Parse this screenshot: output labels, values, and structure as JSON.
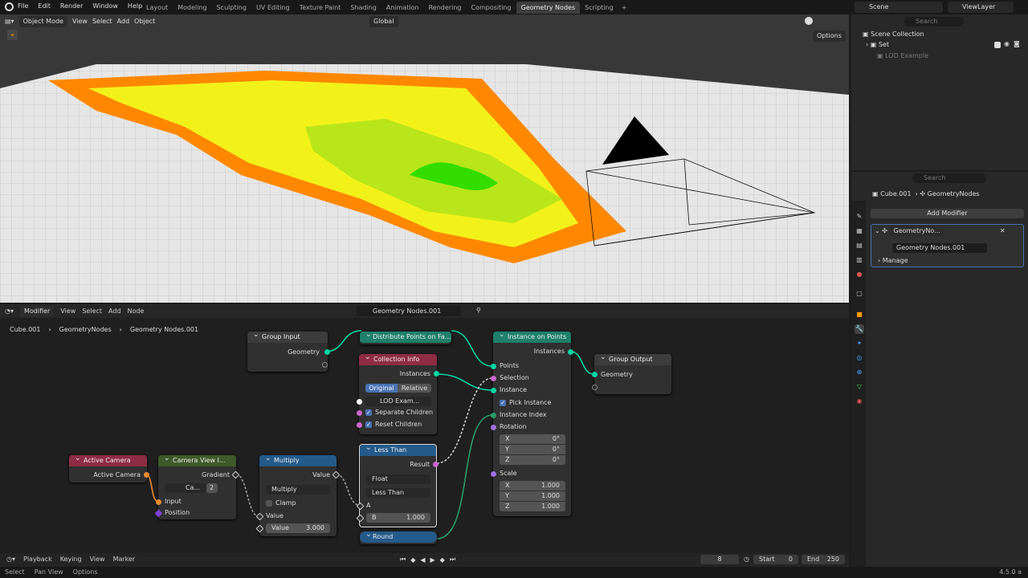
{
  "menu": [
    "File",
    "Edit",
    "Render",
    "Window",
    "Help"
  ],
  "workspaces": [
    "Layout",
    "Modeling",
    "Sculpting",
    "UV Editing",
    "Texture Paint",
    "Shading",
    "Animation",
    "Rendering",
    "Compositing",
    "Geometry Nodes",
    "Scripting"
  ],
  "active_workspace": "Geometry Nodes",
  "scene": "Scene",
  "view_layer": "ViewLayer",
  "viewport": {
    "mode": "Object Mode",
    "menus": [
      "View",
      "Select",
      "Add",
      "Object"
    ],
    "orientation": "Global",
    "options": "Options"
  },
  "outliner": {
    "search_placeholder": "Search",
    "root": "Scene Collection",
    "items": [
      {
        "label": "Set"
      },
      {
        "label": "LOD Example"
      }
    ]
  },
  "properties": {
    "search_placeholder": "Search",
    "object": "Cube.001",
    "modifier_name": "GeometryNodes",
    "add_modifier": "Add Modifier",
    "modifier_short": "GeometryNo...",
    "node_group": "Geometry Nodes.001",
    "manage": "Manage"
  },
  "node_editor": {
    "type": "Modifier",
    "menus": [
      "View",
      "Select",
      "Add",
      "Node"
    ],
    "group": "Geometry Nodes.001",
    "breadcrumb": [
      "Cube.001",
      "GeometryNodes",
      "Geometry Nodes.001"
    ]
  },
  "nodes": {
    "group_input": {
      "title": "Group Input",
      "geometry": "Geometry"
    },
    "distribute": {
      "title": "Distribute Points on Fa..."
    },
    "instance_on_points": {
      "title": "Instance on Points",
      "instances": "Instances",
      "points": "Points",
      "selection": "Selection",
      "instance": "Instance",
      "pick_instance": "Pick Instance",
      "instance_index": "Instance Index",
      "rotation": "Rotation",
      "rx": "X",
      "rxv": "0°",
      "ry": "Y",
      "ryv": "0°",
      "rz": "Z",
      "rzv": "0°",
      "scale": "Scale",
      "sx": "X",
      "sxv": "1.000",
      "sy": "Y",
      "syv": "1.000",
      "sz": "Z",
      "szv": "1.000"
    },
    "group_output": {
      "title": "Group Output",
      "geometry": "Geometry"
    },
    "collection_info": {
      "title": "Collection Info",
      "instances": "Instances",
      "original": "Original",
      "relative": "Relative",
      "collection": "LOD Exam...",
      "separate_children": "Separate Children",
      "reset_children": "Reset Children"
    },
    "active_camera": {
      "title": "Active Camera",
      "output": "Active Camera"
    },
    "camera_view": {
      "title": "Camera View I...",
      "gradient": "Gradient",
      "camera": "Ca...",
      "users": "2",
      "input": "Input",
      "position": "Position"
    },
    "multiply": {
      "title": "Multiply",
      "value_out": "Value",
      "op": "Multiply",
      "clamp": "Clamp",
      "value_in": "Value",
      "value_field_label": "Value",
      "value_field": "3.000"
    },
    "less_than": {
      "title": "Less Than",
      "result": "Result",
      "type": "Float",
      "op": "Less Than",
      "a": "A",
      "b": "B",
      "b_value": "1.000"
    },
    "round": {
      "title": "Round"
    }
  },
  "timeline": {
    "menus": [
      "Playback",
      "Keying",
      "View",
      "Marker"
    ],
    "frame": "8",
    "start_label": "Start",
    "start": "0",
    "end_label": "End",
    "end": "250"
  },
  "status": {
    "select": "Select",
    "pan": "Pan View",
    "options": "Options",
    "version": "4.5.0 a"
  },
  "colors": {
    "accent": "#4772b3",
    "geometry_socket": "#00d6a3",
    "orange": "#ff8c00",
    "yellow": "#ffff00",
    "green": "#5fdd00"
  }
}
